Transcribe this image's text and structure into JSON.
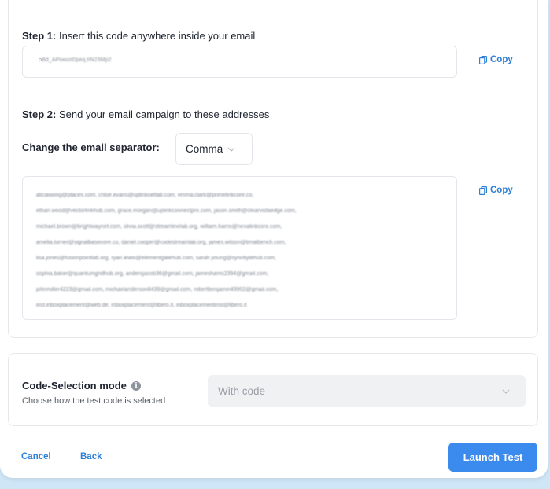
{
  "step1": {
    "label": "Step 1:",
    "text": "Insert this code anywhere inside your email",
    "code_prefix": "p",
    "code": "Bd_APrwsot0peq,hN23Mp2",
    "copy_label": "Copy"
  },
  "step2": {
    "label": "Step 2:",
    "text": "Send your email campaign to these addresses",
    "separator_label": "Change the email separator:",
    "separator_value": "Comma",
    "copy_label": "Copy",
    "addresses": [
      "aliciawong@places.com, chloe.evans@uplinknetlab.com, emma.clark@primelinkcore.co,",
      "ethan.wood@vectorlinkhub.com, grace.morgan@uplinkconnectpro.com, jason.smith@clearvistaedge.com,",
      "michael.brown@brightwaynet.com, olivia.scott@streamlinelab.org, william.harris@nexalinkcore.com,",
      "amelia.turner@signalbasecore.co, daniel.cooper@codestreamlab.org, james.wilson@timalbench.com,",
      "lisa.jones@fusionpointlab.org, ryan.lewis@elementgatehub.com, sarah.young@syncbytehub.com,",
      "sophia.baker@quantumgridhub.org, andersjacob36@gmail.com, jamesharris2394@gmail.com,",
      "johnmiller4223@gmail.com, michaelanderson8439@gmail.com, robertbenjamin43902@gmail.com,",
      "inst.inboxplacement@web.de, inboxplacement@libero.it, inboxplacementinst@libero.it"
    ]
  },
  "mode": {
    "title": "Code-Selection mode",
    "subtitle": "Choose how the test code is selected",
    "value": "With code"
  },
  "footer": {
    "cancel": "Cancel",
    "back": "Back",
    "launch": "Launch Test"
  }
}
